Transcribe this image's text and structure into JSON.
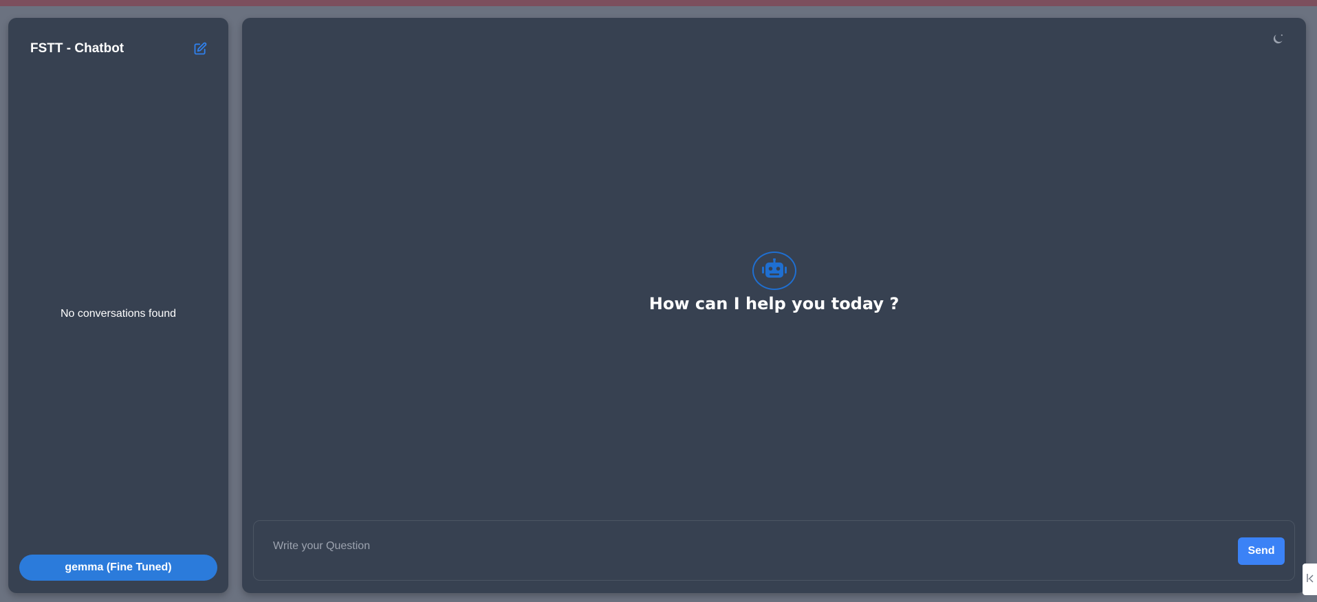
{
  "sidebar": {
    "title": "FSTT - Chatbot",
    "new_chat_icon": "edit-icon",
    "empty_message": "No conversations found",
    "model_button_label": "gemma (Fine Tuned)"
  },
  "main": {
    "theme_toggle_icon": "moon-icon",
    "bot_icon": "robot-icon",
    "welcome_message": "How can I help you today ?",
    "input_placeholder": "Write your Question",
    "input_value": "",
    "send_label": "Send"
  },
  "colors": {
    "panel_bg": "#374151",
    "page_bg": "#6b7280",
    "accent": "#3b82f6",
    "model_button": "#2b7bdb",
    "icon_blue": "#1f6fd1"
  }
}
